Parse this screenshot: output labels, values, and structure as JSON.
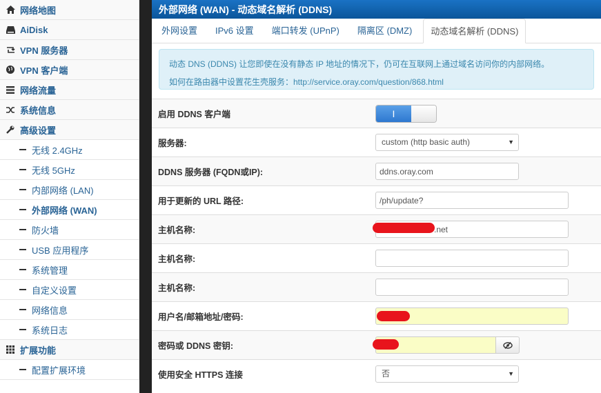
{
  "sidebar": {
    "items": [
      {
        "label": "网络地图",
        "icon": "home-icon",
        "kind": "top"
      },
      {
        "label": "AiDisk",
        "icon": "hdd-icon",
        "kind": "top"
      },
      {
        "label": "VPN 服务器",
        "icon": "retweet-icon",
        "kind": "top"
      },
      {
        "label": "VPN 客户端",
        "icon": "globe-icon",
        "kind": "top"
      },
      {
        "label": "网络流量",
        "icon": "list-icon",
        "kind": "top"
      },
      {
        "label": "系统信息",
        "icon": "random-icon",
        "kind": "top"
      },
      {
        "label": "高级设置",
        "icon": "wrench-icon",
        "kind": "top"
      },
      {
        "label": "无线 2.4GHz",
        "kind": "sub"
      },
      {
        "label": "无线 5GHz",
        "kind": "sub"
      },
      {
        "label": "内部网络 (LAN)",
        "kind": "sub"
      },
      {
        "label": "外部网络 (WAN)",
        "kind": "sub",
        "active": true
      },
      {
        "label": "防火墙",
        "kind": "sub"
      },
      {
        "label": "USB 应用程序",
        "kind": "sub"
      },
      {
        "label": "系统管理",
        "kind": "sub"
      },
      {
        "label": "自定义设置",
        "kind": "sub"
      },
      {
        "label": "网络信息",
        "kind": "sub"
      },
      {
        "label": "系统日志",
        "kind": "sub"
      },
      {
        "label": "扩展功能",
        "icon": "th-icon",
        "kind": "top"
      },
      {
        "label": "配置扩展环境",
        "kind": "sub"
      }
    ]
  },
  "header": {
    "title": "外部网络 (WAN) - 动态域名解析 (DDNS)"
  },
  "tabs": [
    {
      "label": "外网设置"
    },
    {
      "label": "IPv6 设置"
    },
    {
      "label": "端口转发 (UPnP)"
    },
    {
      "label": "隔离区 (DMZ)"
    },
    {
      "label": "动态域名解析 (DDNS)",
      "active": true
    }
  ],
  "info": {
    "line1": "动态 DNS (DDNS) 让您即使在没有静态 IP 地址的情况下，仍可在互联网上通过域名访问你的内部网络。",
    "line2": "如何在路由器中设置花生壳服务：http://service.oray.com/question/868.html"
  },
  "form": {
    "enable_label": "启用 DDNS 客户端",
    "enable_value": "I",
    "server_label": "服务器:",
    "server_value": "custom (http basic auth)",
    "ddns_server_label": "DDNS 服务器 (FQDN或IP):",
    "ddns_server_value": "ddns.oray.com",
    "url_label": "用于更新的 URL 路径:",
    "url_value": "/ph/update?",
    "host1_label": "主机名称:",
    "host1_value": ".net",
    "host2_label": "主机名称:",
    "host2_value": "",
    "host3_label": "主机名称:",
    "host3_value": "",
    "user_label": "用户名/邮箱地址/密码:",
    "user_value": "",
    "pass_label": "密码或 DDNS 密钥:",
    "pass_value": "",
    "https_label": "使用安全 HTTPS 连接",
    "https_value": "否"
  },
  "colors": {
    "accent": "#0e5ea8",
    "link": "#2a6496",
    "info_bg": "#dff0f8",
    "redaction": "#e8141c",
    "autofill": "#fafdc6"
  }
}
